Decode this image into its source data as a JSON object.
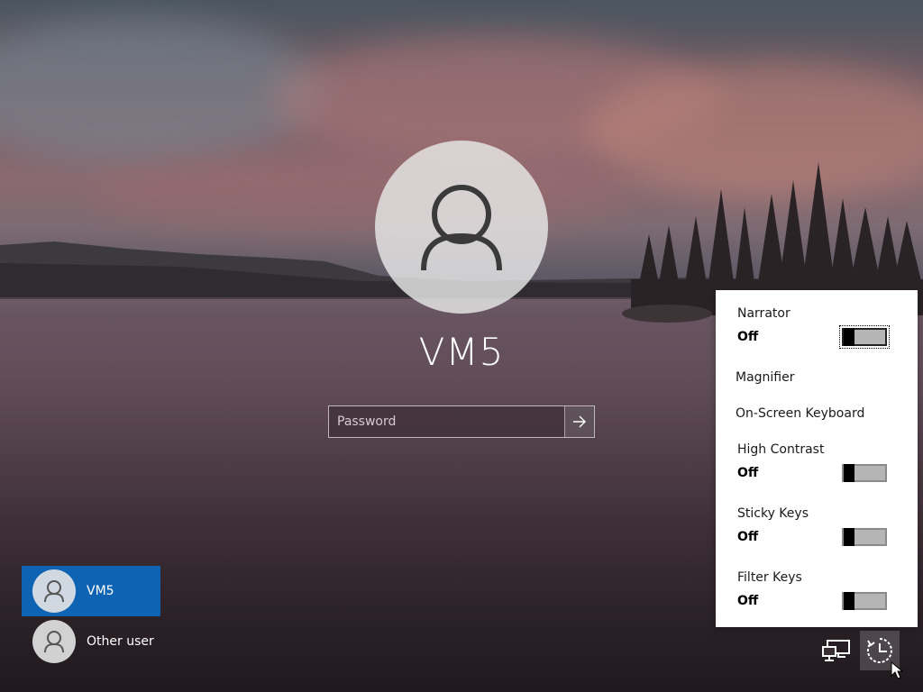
{
  "lock_screen": {
    "user_name": "VM5",
    "password": {
      "placeholder": "Password",
      "value": ""
    }
  },
  "user_list": [
    {
      "name": "VM5",
      "selected": true
    },
    {
      "name": "Other user",
      "selected": false
    }
  ],
  "ease_panel": {
    "narrator": {
      "label": "Narrator",
      "state": "Off",
      "focused": true
    },
    "magnifier": {
      "label": "Magnifier"
    },
    "on_screen_keyboard": {
      "label": "On-Screen Keyboard"
    },
    "high_contrast": {
      "label": "High Contrast",
      "state": "Off"
    },
    "sticky_keys": {
      "label": "Sticky Keys",
      "state": "Off"
    },
    "filter_keys": {
      "label": "Filter Keys",
      "state": "Off"
    }
  },
  "corner_icons": [
    "network-icon",
    "ease-of-access-icon"
  ],
  "colors": {
    "selected_user": "#0f63b3",
    "panel_background": "#ffffff"
  }
}
